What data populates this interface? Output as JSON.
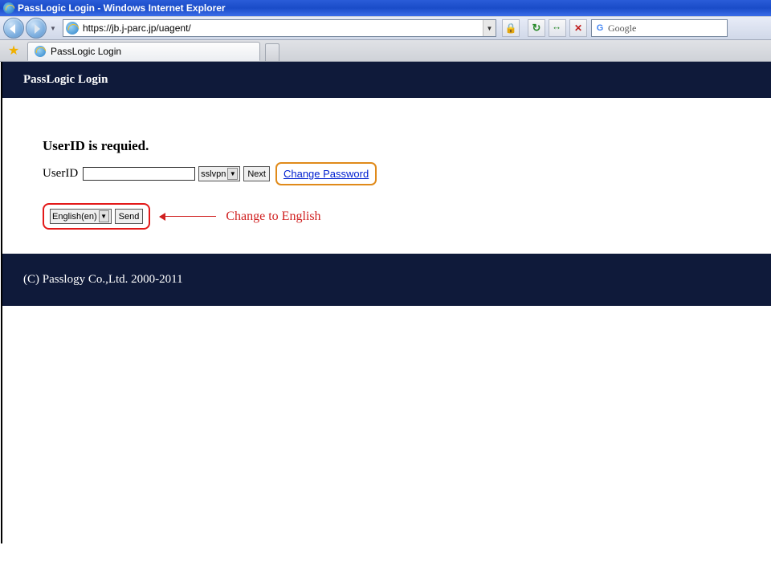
{
  "window": {
    "title": "PassLogic Login - Windows Internet Explorer"
  },
  "address": {
    "url": "https://jb.j-parc.jp/uagent/"
  },
  "search": {
    "provider": "Google",
    "value": ""
  },
  "tab": {
    "title": "PassLogic Login"
  },
  "header": {
    "title": "PassLogic Login"
  },
  "content": {
    "required_message": "UserID is requied.",
    "userid_label": "UserID",
    "userid_value": "",
    "domain_select": "sslvpn",
    "next_button": "Next",
    "change_password_link": "Change Password",
    "language_select": "English(en)",
    "send_button": "Send",
    "annotation": "Change to English"
  },
  "footer": {
    "copyright": "(C) Passlogy Co.,Ltd. 2000-2011"
  }
}
